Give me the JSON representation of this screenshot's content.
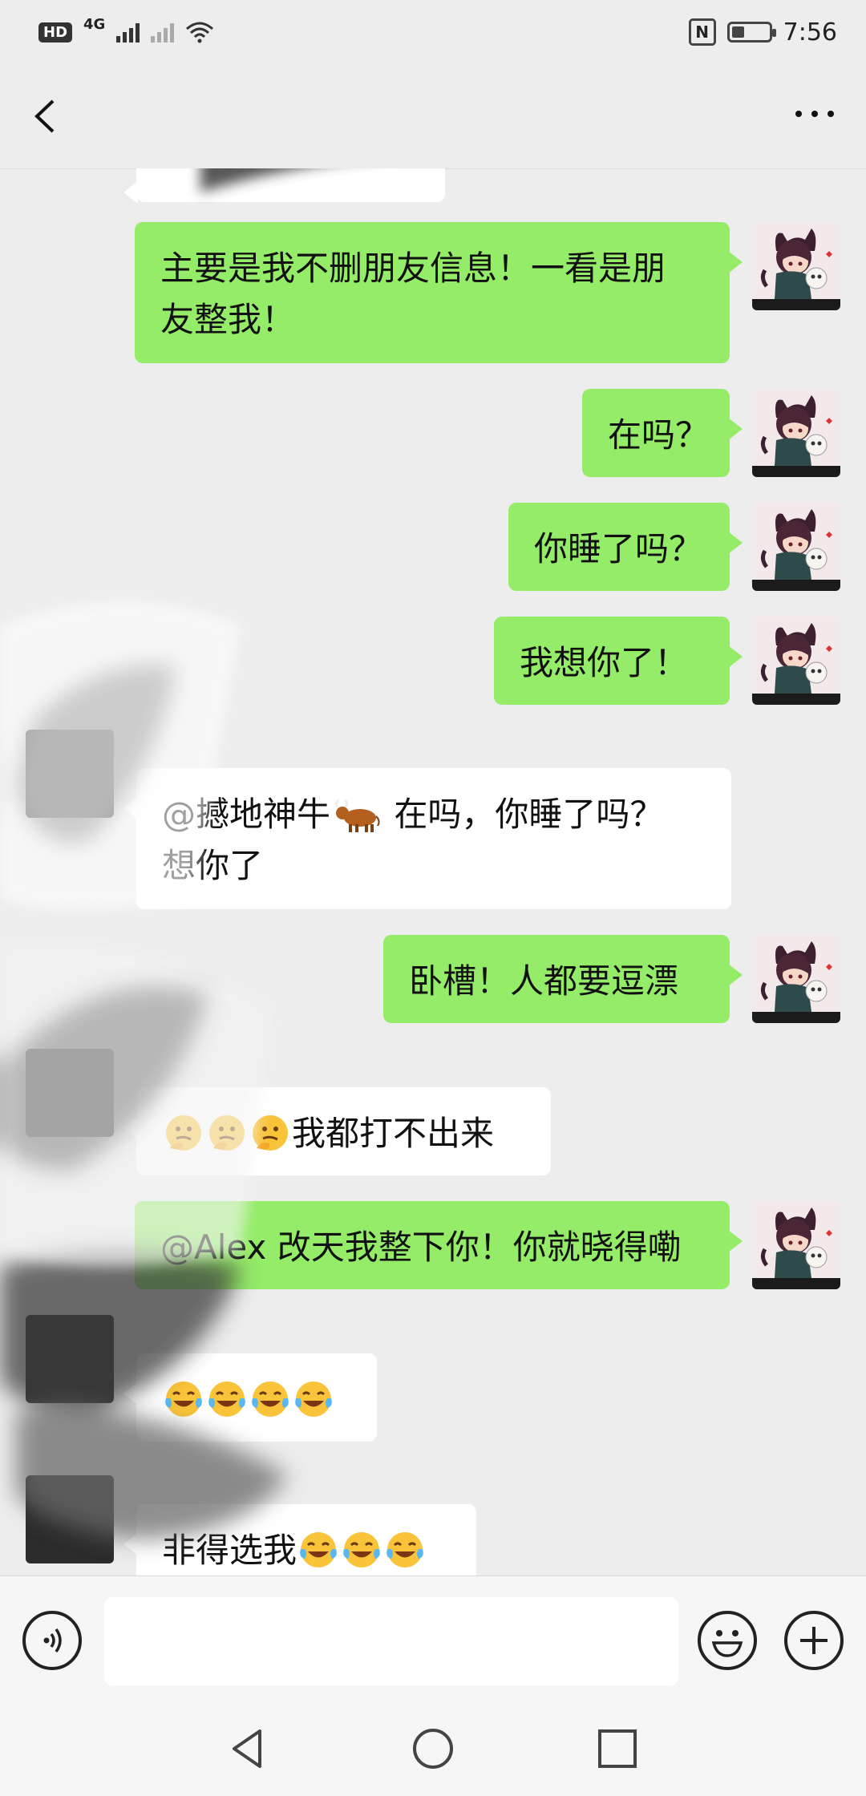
{
  "status_bar": {
    "hd": "HD",
    "network": "4G",
    "time": "7:56",
    "battery_level": 0.35
  },
  "messages": [
    {
      "side": "me",
      "text_lines": [
        "主要是我不删朋友信息！一看是朋",
        "友整我！"
      ]
    },
    {
      "side": "me",
      "text": "在吗？"
    },
    {
      "side": "me",
      "text": "你睡了吗？"
    },
    {
      "side": "me",
      "text": "我想你了！"
    },
    {
      "side": "other",
      "mention": "@撼地神牛",
      "mention_emoji": "ox",
      "text_line1": " 在吗，你睡了吗？",
      "text_line2": "想你了"
    },
    {
      "side": "me",
      "text": "卧槽！人都要逗漂"
    },
    {
      "side": "other",
      "emojis": [
        "thinking",
        "thinking",
        "thinking"
      ],
      "text": "我都打不出来"
    },
    {
      "side": "me",
      "text": "@Alex 改天我整下你！你就晓得嘞"
    },
    {
      "side": "other",
      "emojis": [
        "crying-laughing",
        "crying-laughing",
        "crying-laughing",
        "crying-laughing"
      ]
    },
    {
      "side": "other",
      "text": "非得选我",
      "emojis_after": [
        "crying-laughing",
        "crying-laughing",
        "crying-laughing"
      ]
    }
  ],
  "input_bar": {
    "voice_icon": "voice-icon",
    "emoji_icon": "emoji-icon",
    "plus_icon": "plus-icon"
  },
  "colors": {
    "my_bubble": "#95ec69",
    "other_bubble": "#ffffff",
    "background": "#ededed"
  }
}
